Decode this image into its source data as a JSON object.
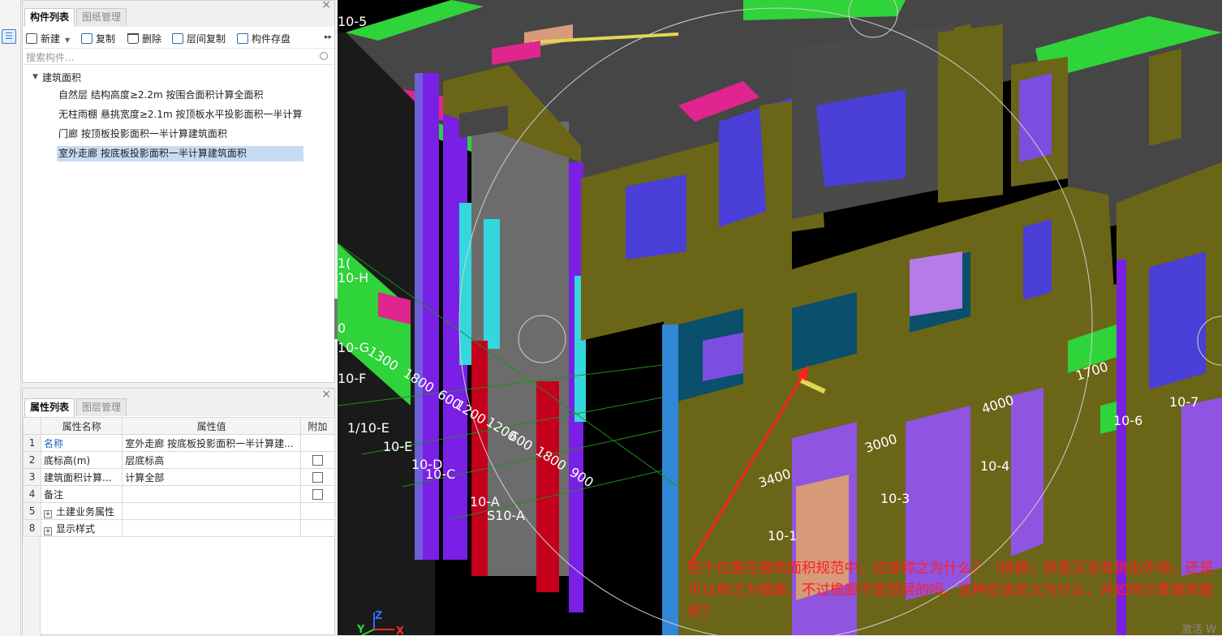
{
  "left_panel": {
    "tabs": [
      "构件列表",
      "图纸管理"
    ],
    "toolbar": [
      "新建",
      "复制",
      "删除",
      "层间复制",
      "构件存盘"
    ],
    "more_glyph": "▸▸",
    "search_placeholder": "搜索构件...",
    "tree_root": "建筑面积",
    "tree_items": [
      "自然层 结构高度≥2.2m 按围合面积计算全面积",
      "无柱雨棚 悬挑宽度≥2.1m 按顶板水平投影面积一半计算",
      "门廊 按顶板投影面积一半计算建筑面积",
      "室外走廊 按底板投影面积一半计算建筑面积"
    ]
  },
  "prop_panel": {
    "tabs": [
      "属性列表",
      "图层管理"
    ],
    "headers": [
      "属性名称",
      "属性值",
      "附加"
    ],
    "rows": [
      {
        "num": "1",
        "name": "名称",
        "value": "室外走廊 按底板投影面积一半计算建..."
      },
      {
        "num": "2",
        "name": "底标高(m)",
        "value": "层底标高"
      },
      {
        "num": "3",
        "name": "建筑面积计算...",
        "value": "计算全部"
      },
      {
        "num": "4",
        "name": "备注",
        "value": ""
      },
      {
        "num": "5",
        "name": "土建业务属性",
        "value": ""
      },
      {
        "num": "8",
        "name": "显示样式",
        "value": ""
      }
    ]
  },
  "view": {
    "axis_labels": [
      "10-5",
      "10-H",
      "10-G",
      "10-F",
      "1/10-E",
      "10-E",
      "10-D",
      "10-C",
      "10-A",
      "S10-A",
      "10-1",
      "10-3",
      "10-4",
      "10-6",
      "10-7",
      "1(",
      "0"
    ],
    "dimensions": [
      "1300",
      "1800",
      "600",
      "1200",
      "1200",
      "600",
      "1800",
      "900",
      "3400",
      "3000",
      "4000",
      "1700"
    ],
    "gizmo": [
      "Z",
      "Y",
      "X"
    ],
    "annotation": "这个位置在建筑面积规范中，应该称之为什么？（挑廊；但是又没有挑出外墙，还是可以称之为檐廊，不过檐廊不是首层的吗，这种应该定义为什么，并如何计算建筑面积？",
    "watermark": "激活 W"
  },
  "colors": {
    "wall": "#6b6518",
    "slab": "#4a4a4a",
    "beam": "#2fd33a",
    "column": "#7a1fe6",
    "window": "#4a3fd6",
    "annotation": "#ff2020"
  }
}
